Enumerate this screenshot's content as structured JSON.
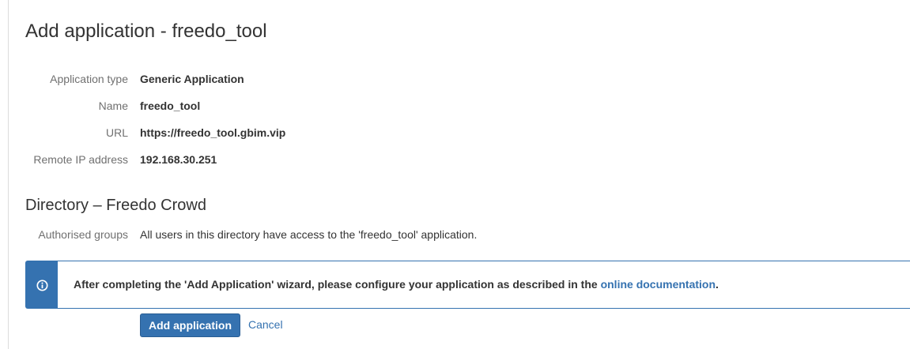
{
  "page_title": "Add application - freedo_tool",
  "details": [
    {
      "label": "Application type",
      "value": "Generic Application"
    },
    {
      "label": "Name",
      "value": "freedo_tool"
    },
    {
      "label": "URL",
      "value": "https://freedo_tool.gbim.vip"
    },
    {
      "label": "Remote IP address",
      "value": "192.168.30.251"
    }
  ],
  "directory": {
    "title": "Directory – Freedo Crowd",
    "groups_label": "Authorised groups",
    "groups_value": "All users in this directory have access to the 'freedo_tool' application."
  },
  "info_banner": {
    "icon": "info-icon",
    "message_prefix": "After completing the 'Add Application' wizard, please configure your application as described in the ",
    "link_text": "online documentation",
    "message_suffix": "."
  },
  "actions": {
    "submit_label": "Add application",
    "cancel_label": "Cancel"
  },
  "colors": {
    "accent": "#3572b0",
    "label": "#707070",
    "text": "#333333"
  }
}
